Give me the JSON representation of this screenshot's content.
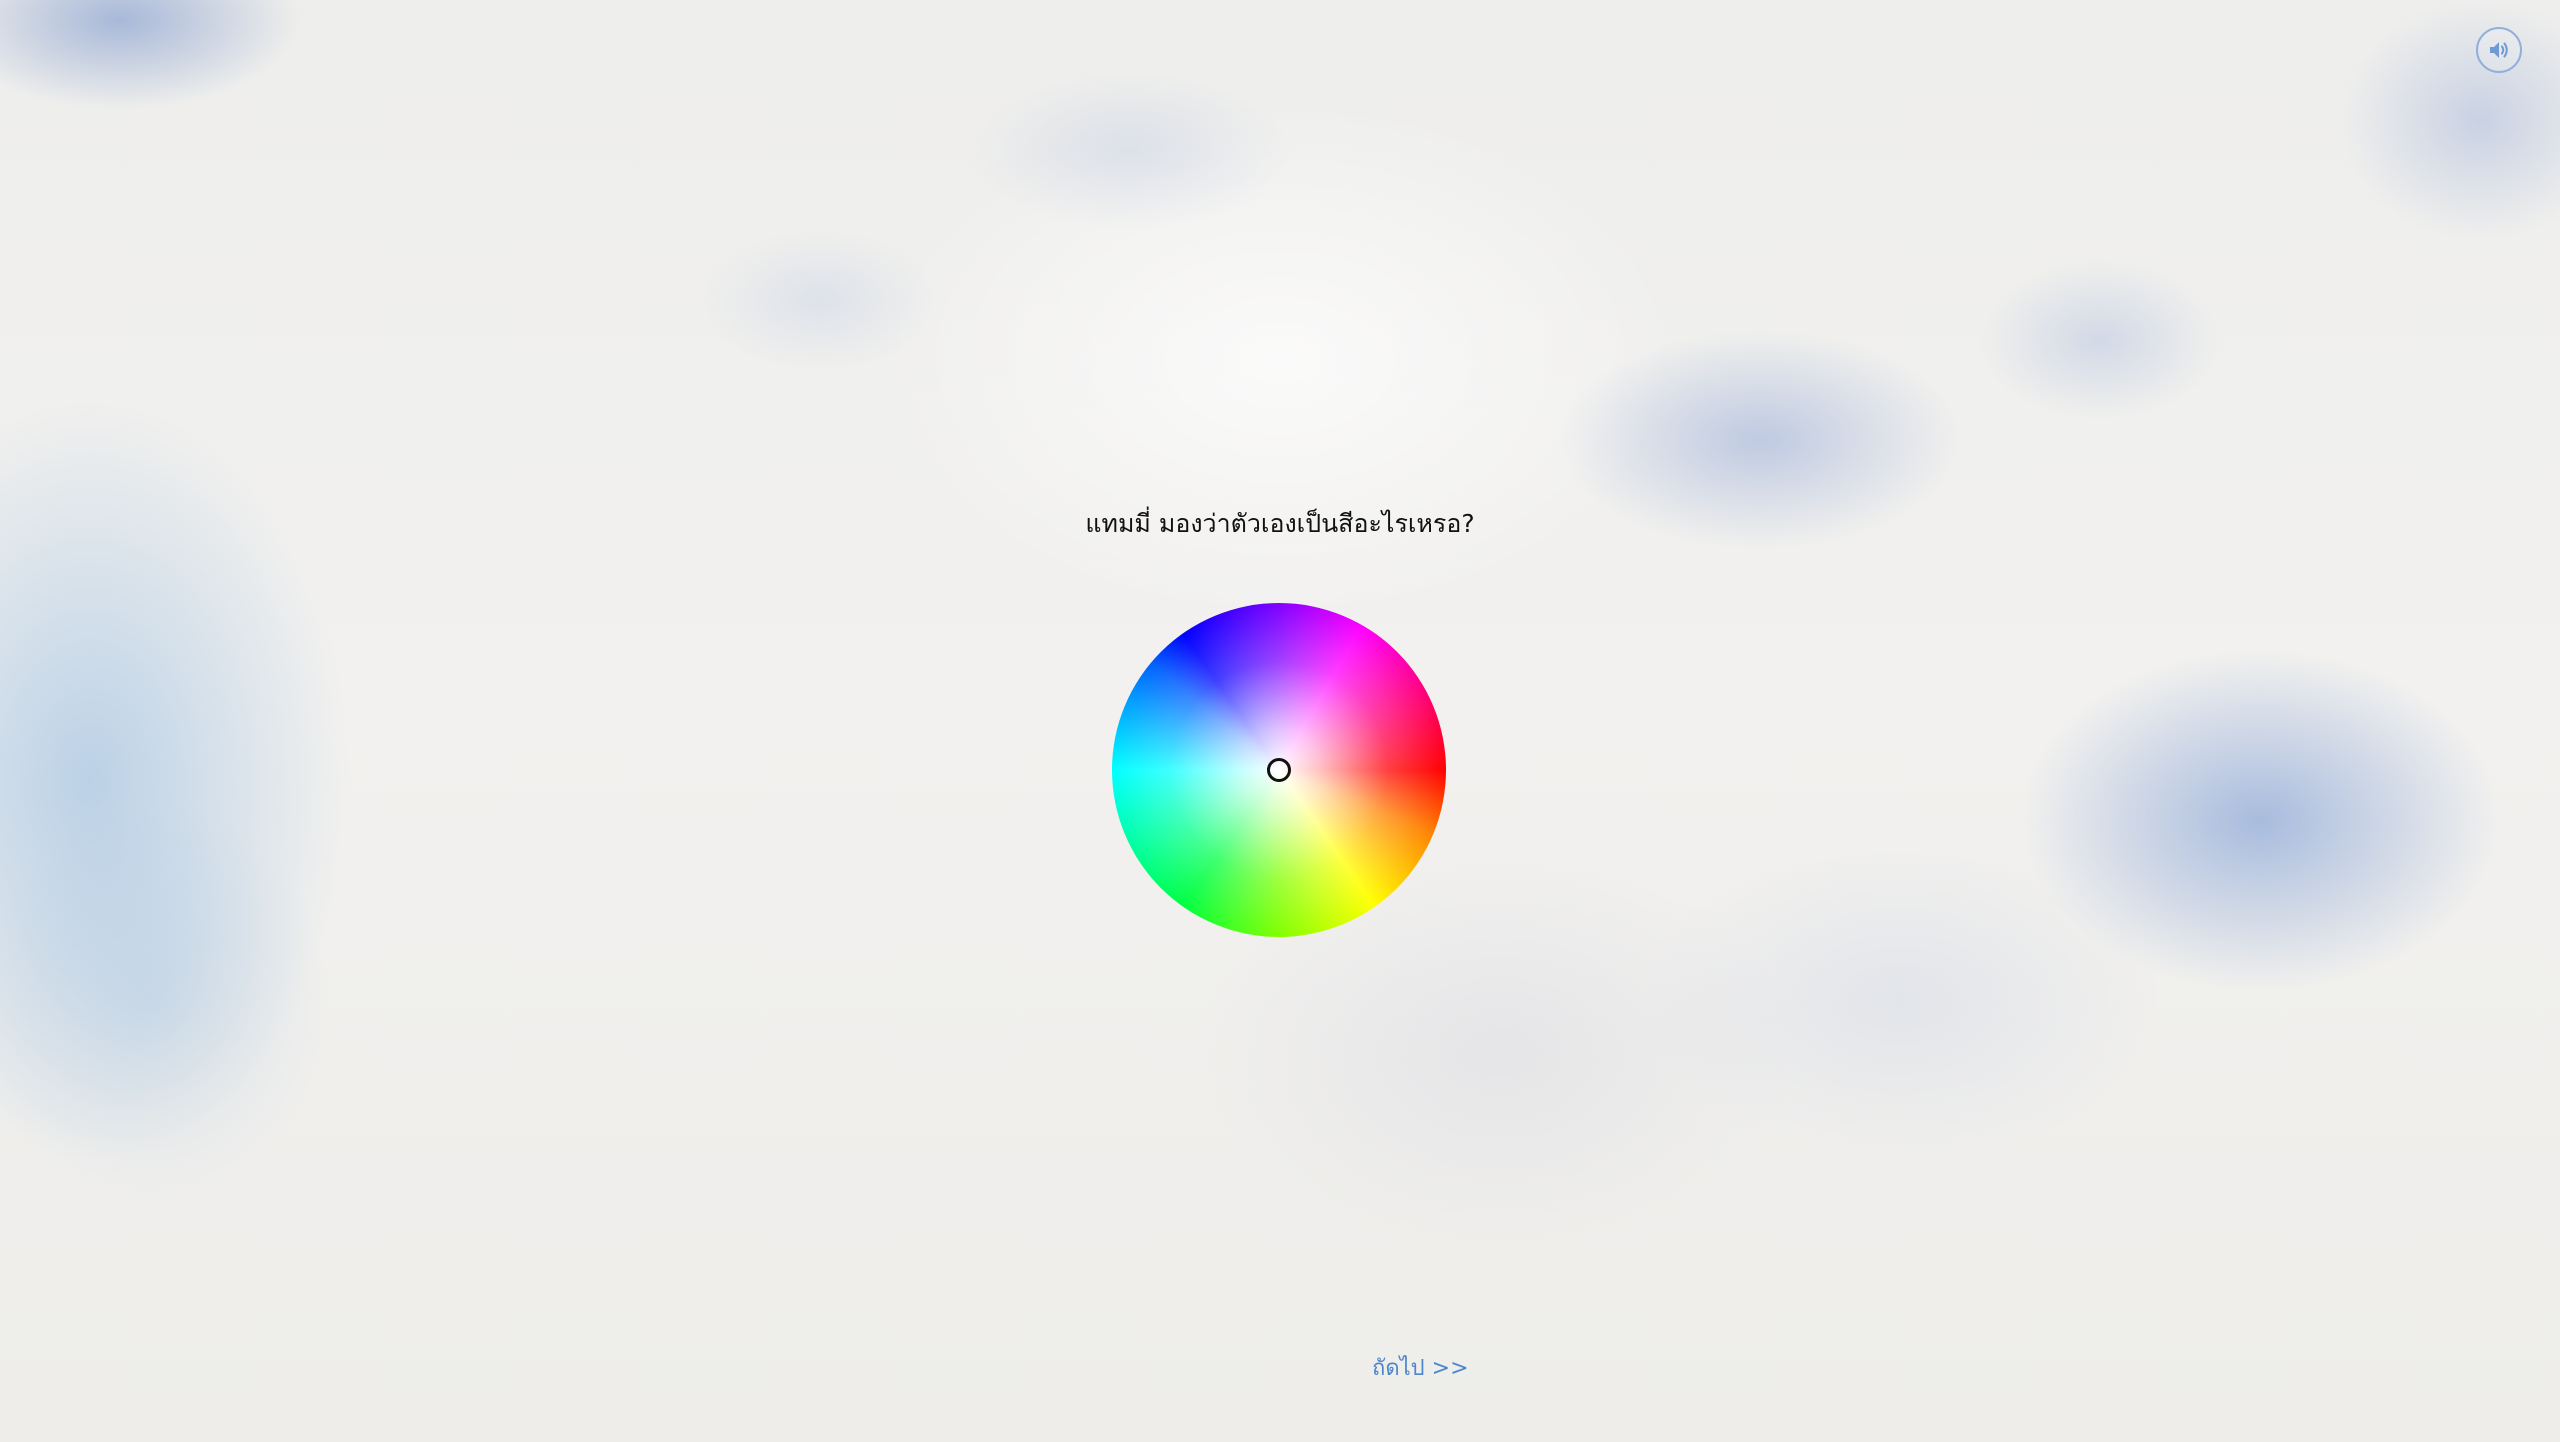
{
  "header": {
    "sound_button": {
      "icon": "speaker-volume-icon"
    }
  },
  "main": {
    "question": "แทมมี่ มองว่าตัวเองเป็นสีอะไรเหรอ?",
    "color_wheel": {
      "selected_color": "#ffffff"
    }
  },
  "footer": {
    "next_label": "ถัดไป >>"
  },
  "colors": {
    "accent": "#4d86cc",
    "text": "#111111"
  }
}
